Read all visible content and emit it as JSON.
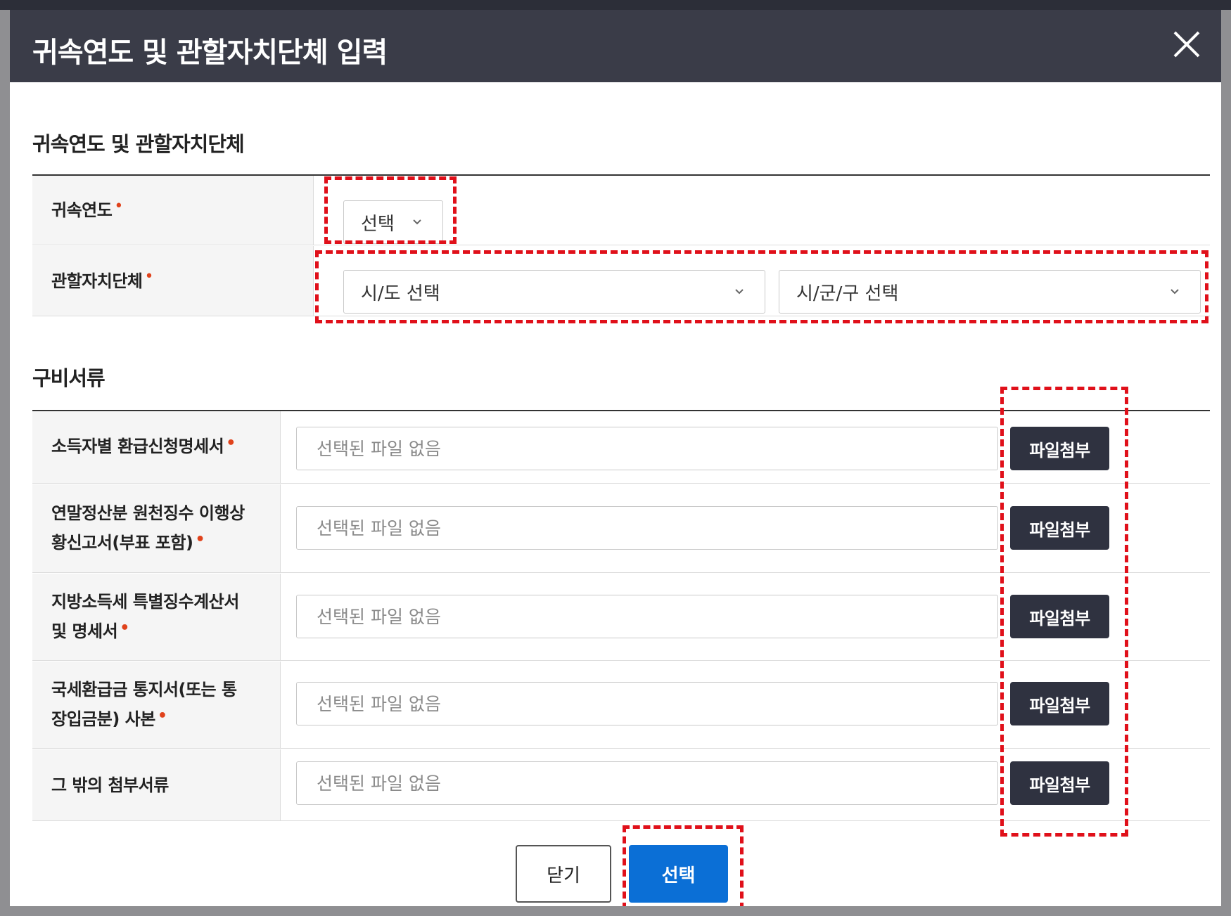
{
  "dialog": {
    "title": "귀속연도 및 관할자치단체 입력"
  },
  "section1": {
    "title": "귀속연도 및 관할자치단체",
    "year_label": "귀속연도",
    "year_select": "선택",
    "region_label": "관할자치단체",
    "sido_select": "시/도 선택",
    "sigungu_select": "시/군/구 선택",
    "required_mark": "•"
  },
  "section2": {
    "title": "구비서류",
    "file_placeholder": "선택된 파일 없음",
    "attach_label": "파일첨부",
    "documents": [
      {
        "line1": "소득자별 환급신청명세서",
        "line2": "",
        "required": true
      },
      {
        "line1": "연말정산분 원천징수 이행상",
        "line2": "황신고서(부표 포함)",
        "required": true
      },
      {
        "line1": "지방소득세 특별징수계산서",
        "line2": "및 명세서",
        "required": true
      },
      {
        "line1": "국세환급금 통지서(또는 통",
        "line2": "장입금분) 사본",
        "required": true
      },
      {
        "line1": "그 밖의 첨부서류",
        "line2": "",
        "required": false
      }
    ]
  },
  "footer": {
    "close_label": "닫기",
    "select_label": "선택"
  },
  "colors": {
    "header_bg": "#3a3c48",
    "primary": "#0b6fd6",
    "attach_bg": "#2f3240",
    "required": "#e0421b",
    "highlight": "#e0101a"
  }
}
